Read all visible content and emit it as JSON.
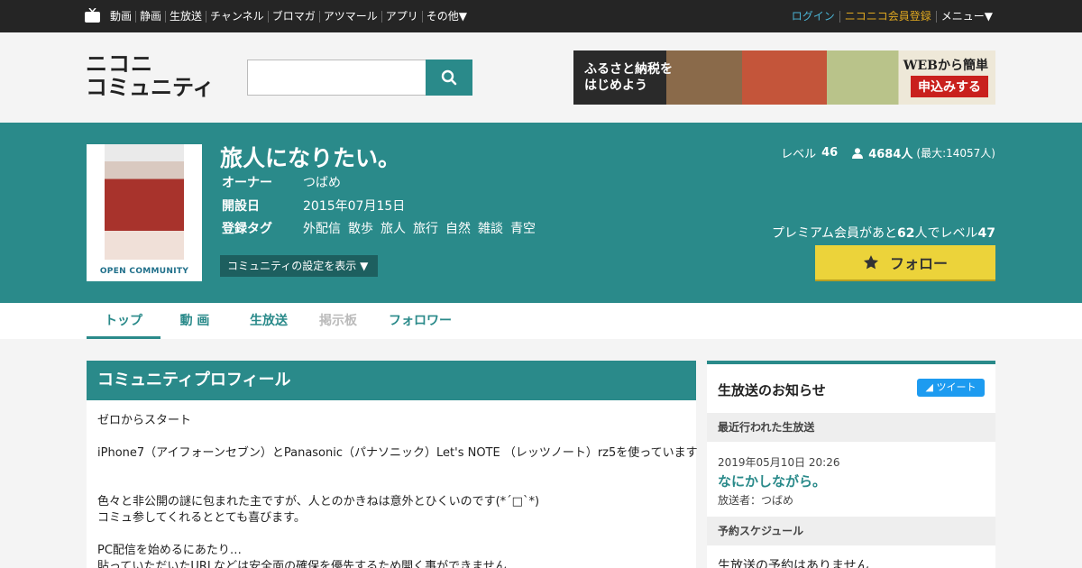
{
  "topbar": {
    "nav": [
      "動画",
      "静画",
      "生放送",
      "チャンネル",
      "ブロマガ",
      "アツマール",
      "アプリ",
      "その他▼"
    ],
    "login": "ログイン",
    "register": "ニコニコ会員登録",
    "menu": "メニュー▼"
  },
  "header": {
    "logo_line1": "ニコニ",
    "logo_line2": "コミュニティ",
    "search_placeholder": "",
    "banner_left": "ふるさと納税をはじめよう",
    "banner_right1": "WEBから簡単",
    "banner_right2": "申込みする"
  },
  "community": {
    "title": "旅人になりたい。",
    "thumb_label": "OPEN COMMUNITY",
    "owner_label": "オーナー",
    "owner": "つばめ",
    "opened_label": "開設日",
    "opened": "2015年07月15日",
    "tags_label": "登録タグ",
    "tags": [
      "外配信",
      "散歩",
      "旅人",
      "旅行",
      "自然",
      "雑談",
      "青空"
    ],
    "settings_button": "コミュニティの設定を表示 ▼",
    "level_label": "レベル",
    "level": "46",
    "members": "4684人",
    "members_max": "(最大:14057人)",
    "premium_text_a": "プレミアム会員があと",
    "premium_count": "62",
    "premium_text_b": "人でレベル",
    "premium_level": "47",
    "follow_button": "フォロー"
  },
  "tabs": [
    "トップ",
    "動 画",
    "生放送",
    "掲示板",
    "フォロワー"
  ],
  "profile": {
    "heading": "コミュニティプロフィール",
    "lines": [
      "ゼロからスタート",
      "",
      "iPhone7（アイフォーンセブン）とPanasonic（パナソニック）Let's NOTE （レッツノート）rz5を使っています",
      "",
      "",
      "色々と非公開の謎に包まれた主ですが、人とのかきねは意外とひくいのです(*´□`*)",
      "コミュ参してくれるととても喜びます。",
      "",
      "PC配信を始めるにあたり…",
      "貼っていただいたURLなどは安全面の確保を優先するため開く事ができません"
    ]
  },
  "side": {
    "title": "生放送のお知らせ",
    "tweet": "ツイート",
    "recent_label": "最近行われた生放送",
    "recent_date": "2019年05月10日 20:26",
    "recent_title": "なにかしながら。",
    "recent_by": "放送者：つばめ",
    "schedule_label": "予約スケジュール",
    "schedule_none": "生放送の予約はありません"
  },
  "colors": {
    "teal": "#2a8a8a",
    "follow": "#ecd33a"
  }
}
